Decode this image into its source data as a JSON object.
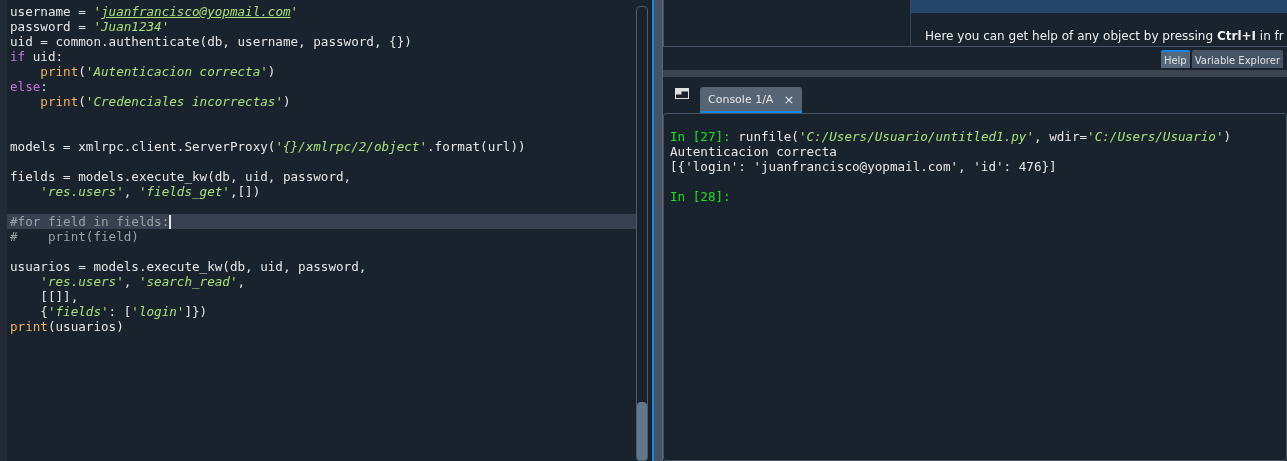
{
  "editor": {
    "lines": [
      {
        "kind": "code",
        "current": false,
        "indented": false,
        "tokens": [
          {
            "t": "username = ",
            "kind": "plain"
          },
          {
            "t": "'",
            "kind": "str"
          },
          {
            "t": "juanfrancisco@yopmail.com",
            "kind": "link"
          },
          {
            "t": "'",
            "kind": "str"
          }
        ]
      },
      {
        "kind": "code",
        "current": false,
        "indented": false,
        "tokens": [
          {
            "t": "password = ",
            "kind": "plain"
          },
          {
            "t": "'Juan1234'",
            "kind": "str"
          }
        ]
      },
      {
        "kind": "code",
        "current": false,
        "indented": false,
        "tokens": [
          {
            "t": "uid = common.authenticate(db, username, password, {})",
            "kind": "plain"
          }
        ]
      },
      {
        "kind": "code",
        "current": false,
        "indented": false,
        "tokens": [
          {
            "t": "if",
            "kind": "kw"
          },
          {
            "t": " uid:",
            "kind": "plain"
          }
        ]
      },
      {
        "kind": "code",
        "current": false,
        "indented": true,
        "tokens": [
          {
            "t": "print",
            "kind": "fn"
          },
          {
            "t": "(",
            "kind": "plain"
          },
          {
            "t": "'Autenticacion correcta'",
            "kind": "str"
          },
          {
            "t": ")",
            "kind": "plain"
          }
        ]
      },
      {
        "kind": "code",
        "current": false,
        "indented": false,
        "tokens": [
          {
            "t": "else",
            "kind": "kw"
          },
          {
            "t": ":",
            "kind": "plain"
          }
        ]
      },
      {
        "kind": "code",
        "current": false,
        "indented": true,
        "tokens": [
          {
            "t": "print",
            "kind": "fn"
          },
          {
            "t": "(",
            "kind": "plain"
          },
          {
            "t": "'Credenciales incorrectas'",
            "kind": "str"
          },
          {
            "t": ")",
            "kind": "plain"
          }
        ]
      },
      {
        "kind": "blank"
      },
      {
        "kind": "blank"
      },
      {
        "kind": "code",
        "current": false,
        "indented": false,
        "tokens": [
          {
            "t": "models = xmlrpc.client.ServerProxy(",
            "kind": "plain"
          },
          {
            "t": "'{}/xmlrpc/2/object'",
            "kind": "str"
          },
          {
            "t": ".format(url))",
            "kind": "plain"
          }
        ]
      },
      {
        "kind": "blank"
      },
      {
        "kind": "code",
        "current": false,
        "indented": false,
        "tokens": [
          {
            "t": "fields = models.execute_kw(db, uid, password,",
            "kind": "plain"
          }
        ]
      },
      {
        "kind": "code",
        "current": false,
        "indented": true,
        "tokens": [
          {
            "t": "'res.users'",
            "kind": "str"
          },
          {
            "t": ", ",
            "kind": "plain"
          },
          {
            "t": "'fields_get'",
            "kind": "str"
          },
          {
            "t": ",[])",
            "kind": "plain"
          }
        ]
      },
      {
        "kind": "blank"
      },
      {
        "kind": "code",
        "current": true,
        "indented": false,
        "tokens": [
          {
            "t": "#for field in fields:",
            "kind": "cmt"
          }
        ]
      },
      {
        "kind": "code",
        "current": false,
        "indented": false,
        "tokens": [
          {
            "t": "#    print(field)",
            "kind": "cmt"
          }
        ]
      },
      {
        "kind": "blank"
      },
      {
        "kind": "code",
        "current": false,
        "indented": false,
        "tokens": [
          {
            "t": "usuarios = models.execute_kw(db, uid, password,",
            "kind": "plain"
          }
        ]
      },
      {
        "kind": "code",
        "current": false,
        "indented": true,
        "tokens": [
          {
            "t": "'res.users'",
            "kind": "str"
          },
          {
            "t": ", ",
            "kind": "plain"
          },
          {
            "t": "'search_read'",
            "kind": "str"
          },
          {
            "t": ",",
            "kind": "plain"
          }
        ]
      },
      {
        "kind": "code",
        "current": false,
        "indented": true,
        "tokens": [
          {
            "t": "[[]],",
            "kind": "plain"
          }
        ]
      },
      {
        "kind": "code",
        "current": false,
        "indented": true,
        "tokens": [
          {
            "t": "{",
            "kind": "plain"
          },
          {
            "t": "'fields'",
            "kind": "str"
          },
          {
            "t": ": [",
            "kind": "plain"
          },
          {
            "t": "'login'",
            "kind": "str"
          },
          {
            "t": "]})",
            "kind": "plain"
          }
        ]
      },
      {
        "kind": "code",
        "current": false,
        "indented": false,
        "tokens": [
          {
            "t": "print",
            "kind": "fn"
          },
          {
            "t": "(usuarios)",
            "kind": "plain"
          }
        ]
      }
    ]
  },
  "help": {
    "text": "Here you can get help of any object by pressing **Ctrl+I** in fr",
    "tabs": [
      {
        "label": "Help",
        "selected": true
      },
      {
        "label": "Variable Explorer",
        "selected": false
      }
    ]
  },
  "console": {
    "tabs": [
      {
        "label": "Console 1/A",
        "close": "×",
        "selected": true
      }
    ],
    "lines": [
      {
        "kind": "code",
        "tokens": [
          {
            "t": "In [27]:",
            "kind": "prompt"
          },
          {
            "t": " runfile(",
            "kind": "plain"
          },
          {
            "t": "'C:/Users/Usuario/untitled1.py'",
            "kind": "str"
          },
          {
            "t": ", wdir=",
            "kind": "plain"
          },
          {
            "t": "'C:/Users/Usuario'",
            "kind": "str"
          },
          {
            "t": ")",
            "kind": "plain"
          }
        ]
      },
      {
        "kind": "code",
        "tokens": [
          {
            "t": "Autenticacion correcta",
            "kind": "plain"
          }
        ]
      },
      {
        "kind": "code",
        "tokens": [
          {
            "t": "[{'login': 'juanfrancisco@yopmail.com', 'id': 476}]",
            "kind": "plain"
          }
        ]
      },
      {
        "kind": "blank"
      },
      {
        "kind": "code",
        "tokens": [
          {
            "t": "In [28]:",
            "kind": "prompt"
          }
        ]
      }
    ]
  }
}
